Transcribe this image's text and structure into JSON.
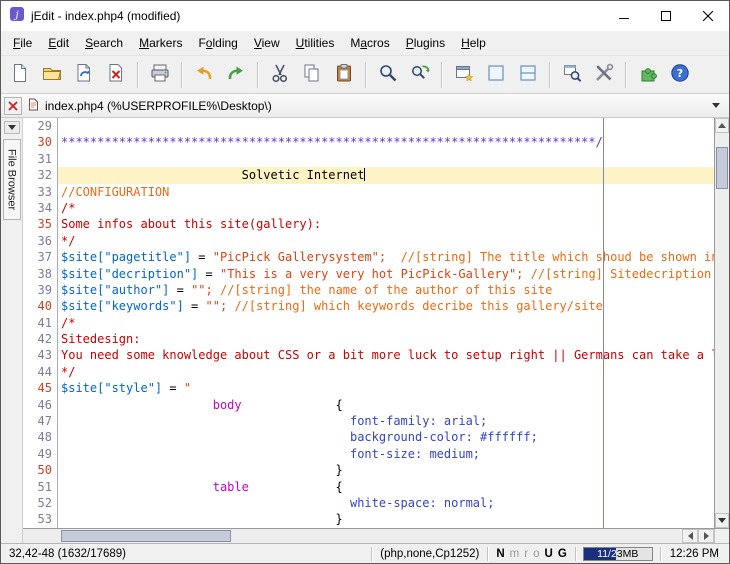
{
  "window": {
    "title": "jEdit - index.php4 (modified)"
  },
  "menu": {
    "items": [
      {
        "label": "File",
        "m": 0
      },
      {
        "label": "Edit",
        "m": 0
      },
      {
        "label": "Search",
        "m": 0
      },
      {
        "label": "Markers",
        "m": 0
      },
      {
        "label": "Folding",
        "m": 1
      },
      {
        "label": "View",
        "m": 0
      },
      {
        "label": "Utilities",
        "m": 0
      },
      {
        "label": "Macros",
        "m": 1
      },
      {
        "label": "Plugins",
        "m": 0
      },
      {
        "label": "Help",
        "m": 0
      }
    ]
  },
  "toolbar": {
    "buttons": [
      "new-file",
      "open-file",
      "save-file",
      "close-buffer",
      "print",
      "undo",
      "redo",
      "cut",
      "copy",
      "paste",
      "find",
      "search-and-replace",
      "new-view",
      "unsplit",
      "split-horizontally",
      "search-in-directory",
      "global-options",
      "plugin-manager",
      "help"
    ]
  },
  "buffer_bar": {
    "file_label": "index.php4 (%USERPROFILE%\\Desktop\\)"
  },
  "dock": {
    "label": "File Browser"
  },
  "editor": {
    "current_line": 32,
    "gutter_highlight_interval": 5,
    "lines": [
      {
        "n": 29,
        "seg": []
      },
      {
        "n": 30,
        "seg": [
          [
            "c3",
            "**************************************************************************/"
          ]
        ]
      },
      {
        "n": 31,
        "seg": []
      },
      {
        "n": 32,
        "caret": true,
        "seg": [
          [
            "p",
            "                         Solvetic Internet"
          ]
        ]
      },
      {
        "n": 33,
        "seg": [
          [
            "c2",
            "//CONFIGURATION"
          ]
        ]
      },
      {
        "n": 34,
        "seg": [
          [
            "c1",
            "/*"
          ]
        ]
      },
      {
        "n": 35,
        "seg": [
          [
            "c1",
            "Some infos about this site(gallery):"
          ]
        ]
      },
      {
        "n": 36,
        "seg": [
          [
            "c1",
            "*/"
          ]
        ]
      },
      {
        "n": 37,
        "seg": [
          [
            "kw",
            "$site[\"pagetitle\"]"
          ],
          [
            "p",
            " = "
          ],
          [
            "lit",
            "\"PicPick Gallerysystem\";"
          ],
          [
            "p",
            "  "
          ],
          [
            "c2",
            "//[string] The title which shoud be shown in the"
          ]
        ]
      },
      {
        "n": 38,
        "seg": [
          [
            "kw",
            "$site[\"decription\"]"
          ],
          [
            "p",
            " = "
          ],
          [
            "lit",
            "\"This is a very very hot PicPick-Gallery\";"
          ],
          [
            "p",
            " "
          ],
          [
            "c2",
            "//[string] Sitedecription"
          ]
        ]
      },
      {
        "n": 39,
        "seg": [
          [
            "kw",
            "$site[\"author\"]"
          ],
          [
            "p",
            " = "
          ],
          [
            "lit",
            "\"\";"
          ],
          [
            "p",
            " "
          ],
          [
            "c2",
            "//[string] the name of the author of this site"
          ]
        ]
      },
      {
        "n": 40,
        "seg": [
          [
            "kw",
            "$site[\"keywords\"]"
          ],
          [
            "p",
            " = "
          ],
          [
            "lit",
            "\"\";"
          ],
          [
            "p",
            " "
          ],
          [
            "c2",
            "//[string] which keywords decribe this gallery/site"
          ]
        ]
      },
      {
        "n": 41,
        "seg": [
          [
            "c1",
            "/*"
          ]
        ]
      },
      {
        "n": 42,
        "seg": [
          [
            "c1",
            "Sitedesign:"
          ]
        ]
      },
      {
        "n": 43,
        "seg": [
          [
            "c1",
            "You need some knowledge about CSS or a bit more luck to setup right || Germans can take a look to"
          ]
        ]
      },
      {
        "n": 44,
        "seg": [
          [
            "c1",
            "*/"
          ]
        ]
      },
      {
        "n": 45,
        "seg": [
          [
            "kw",
            "$site[\"style\"]"
          ],
          [
            "p",
            " = "
          ],
          [
            "lit",
            "\""
          ]
        ]
      },
      {
        "n": 46,
        "seg": [
          [
            "p",
            "                     "
          ],
          [
            "sel",
            "body"
          ],
          [
            "p",
            "             {"
          ]
        ]
      },
      {
        "n": 47,
        "seg": [
          [
            "p",
            "                                        "
          ],
          [
            "css",
            "font-family: arial;"
          ]
        ]
      },
      {
        "n": 48,
        "seg": [
          [
            "p",
            "                                        "
          ],
          [
            "css",
            "background-color: #ffffff;"
          ]
        ]
      },
      {
        "n": 49,
        "seg": [
          [
            "p",
            "                                        "
          ],
          [
            "css",
            "font-size: medium;"
          ]
        ]
      },
      {
        "n": 50,
        "seg": [
          [
            "p",
            "                                      }"
          ]
        ]
      },
      {
        "n": 51,
        "seg": [
          [
            "p",
            "                     "
          ],
          [
            "sel",
            "table"
          ],
          [
            "p",
            "            {"
          ]
        ]
      },
      {
        "n": 52,
        "seg": [
          [
            "p",
            "                                        "
          ],
          [
            "css",
            "white-space: normal;"
          ]
        ]
      },
      {
        "n": 53,
        "seg": [
          [
            "p",
            "                                      }"
          ]
        ]
      }
    ]
  },
  "status_bar": {
    "caret_position": "32,42-48 (1632/17689)",
    "mode": "(php,none,Cp1252)",
    "indicators": [
      {
        "t": "N",
        "on": true
      },
      {
        "t": "m",
        "on": false
      },
      {
        "t": "r",
        "on": false
      },
      {
        "t": "o",
        "on": false
      },
      {
        "t": "U",
        "on": true
      },
      {
        "t": "G",
        "on": true
      }
    ],
    "memory": {
      "label": "11/23MB",
      "fill_percent": 48
    },
    "clock": "12:26 PM"
  },
  "colors": {
    "variable_blue": "#0066cc",
    "comment_block_red": "#cc0000",
    "comment_line_orange": "#ee6a10",
    "comment_banner_purple": "#6633cc",
    "string_literal": "#dd4411",
    "css_selector_magenta": "#cc00cc",
    "css_property_blue": "#3344cc",
    "current_line_highlight": "#fdf3c5",
    "wrap_guide": "#7788cc",
    "memory_gauge_fill": "#1b2f7e"
  }
}
